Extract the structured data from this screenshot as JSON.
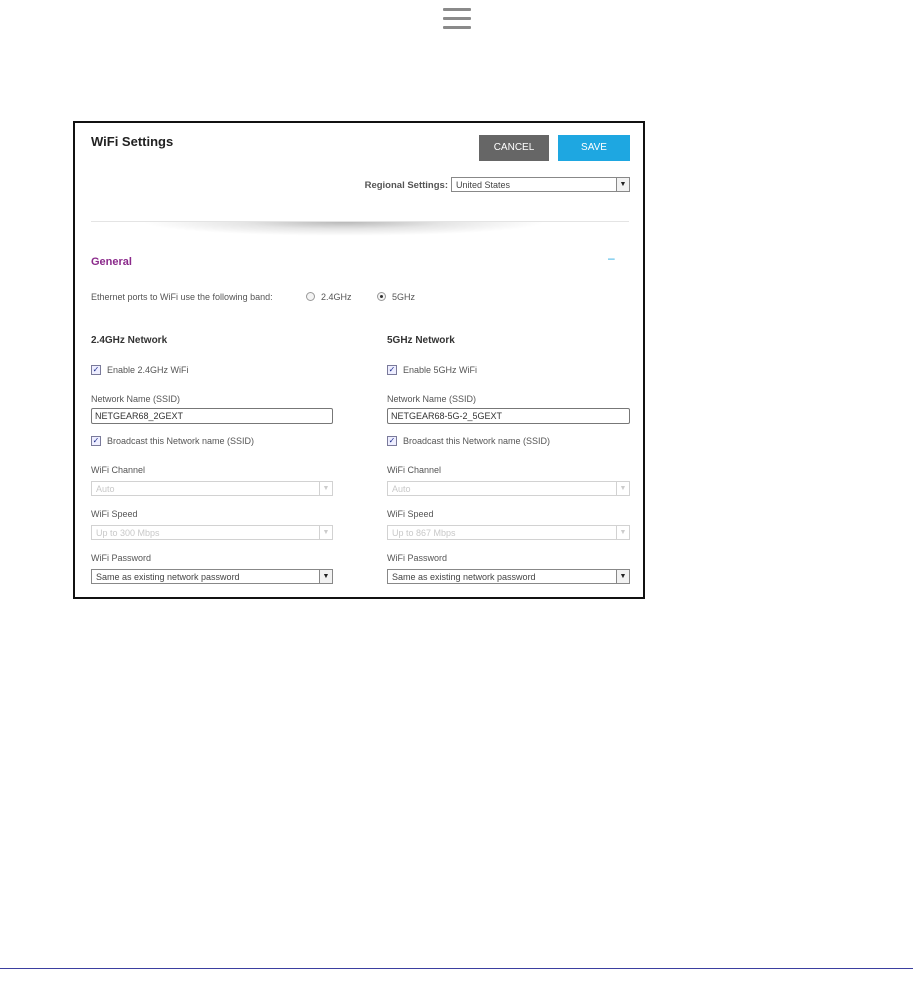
{
  "header": {
    "menu_icon": "hamburger-menu-icon"
  },
  "panel": {
    "title": "WiFi Settings",
    "cancel_label": "CANCEL",
    "save_label": "SAVE",
    "regional_label": "Regional Settings:",
    "regional_value": "United States"
  },
  "general": {
    "heading": "General",
    "collapse_symbol": "–",
    "band_label": "Ethernet ports to WiFi use the following band:",
    "band_options": [
      {
        "label": "2.4GHz",
        "checked": false
      },
      {
        "label": "5GHz",
        "checked": true
      }
    ]
  },
  "networks": [
    {
      "heading": "2.4GHz Network",
      "enable_label": "Enable 2.4GHz WiFi",
      "ssid_label": "Network Name (SSID)",
      "ssid_value": "NETGEAR68_2GEXT",
      "broadcast_label": "Broadcast this Network name (SSID)",
      "channel_label": "WiFi Channel",
      "channel_value": "Auto",
      "speed_label": "WiFi Speed",
      "speed_value": "Up to 300 Mbps",
      "password_label": "WiFi Password",
      "password_value": "Same as existing network password"
    },
    {
      "heading": "5GHz Network",
      "enable_label": "Enable 5GHz WiFi",
      "ssid_label": "Network Name (SSID)",
      "ssid_value": "NETGEAR68-5G-2_5GEXT",
      "broadcast_label": "Broadcast this Network name (SSID)",
      "channel_label": "WiFi Channel",
      "channel_value": "Auto",
      "speed_label": "WiFi Speed",
      "speed_value": "Up to 867 Mbps",
      "password_label": "WiFi Password",
      "password_value": "Same as existing network password"
    }
  ],
  "colors": {
    "accent": "#1ea7e1",
    "section_heading": "#8b2a8b",
    "cancel": "#666666"
  }
}
